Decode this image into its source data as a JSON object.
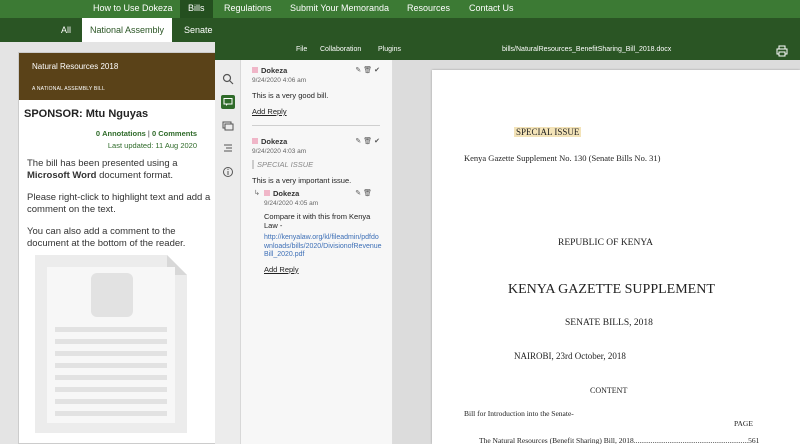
{
  "topnav": [
    "How to Use Dokeza",
    "Bills",
    "Regulations",
    "Submit Your Memoranda",
    "Resources",
    "Contact Us"
  ],
  "subnav": [
    "All",
    "National Assembly",
    "Senate"
  ],
  "bill": {
    "title": "Natural Resources 2018",
    "house": "A NATIONAL ASSEMBLY BILL",
    "sponsor": "SPONSOR: Mtu Nguyas",
    "annotations_count": "0",
    "annotations_label": "Annotations",
    "comments_count": "0",
    "comments_label": "Comments",
    "last_updated": "Last updated: 11 Aug 2020",
    "desc1_pre": "The bill has been presented using a",
    "desc1_bold": "Microsoft Word",
    "desc1_post": "document format.",
    "desc2": "Please right-click to highlight text and add a comment on the text.",
    "desc3": "You can also add a comment to the document at the bottom of the reader."
  },
  "viewer": {
    "menu": [
      "File",
      "Collaboration",
      "Plugins"
    ],
    "filename": "bills/NaturalResources_BenefitSharing_Bill_2018.docx",
    "rail_icons": [
      "search-icon",
      "comment-icon",
      "comments-list-icon",
      "outline-icon",
      "info-icon"
    ]
  },
  "comments": [
    {
      "author": "Dokeza",
      "date": "9/24/2020 4:06 am",
      "text": "This is a very good bill.",
      "reply": "Add Reply"
    },
    {
      "author": "Dokeza",
      "date": "9/24/2020 4:03 am",
      "quote": "SPECIAL ISSUE",
      "text": "This is a very important issue.",
      "child": {
        "author": "Dokeza",
        "date": "9/24/2020 4:05 am",
        "text": "Compare it with this from Kenya Law -",
        "link": "http://kenyalaw.org/kl/fileadmin/pdfdownloads/bills/2020/DivisionofRevenueBill_2020.pdf",
        "reply": "Add Reply"
      }
    }
  ],
  "document": {
    "special_issue": "SPECIAL ISSUE",
    "gazette_line": "Kenya Gazette Supplement No. 130 (Senate Bills No. 31)",
    "republic": "REPUBLIC OF KENYA",
    "supplement": "KENYA GAZETTE SUPPLEMENT",
    "senate_bills": "SENATE BILLS, 2018",
    "dateline": "NAIROBI, 23rd October, 2018",
    "content": "CONTENT",
    "intro": "Bill for Introduction into the Senate-",
    "page_label": "PAGE",
    "toc_item": "The Natural Resources (Benefit Sharing) Bill, 2018",
    "toc_page": "561"
  },
  "colors": {
    "nav": "#3c7a34",
    "subnav": "#2a5524",
    "card_head": "#5a4218",
    "highlight": "#f3e3b8"
  }
}
